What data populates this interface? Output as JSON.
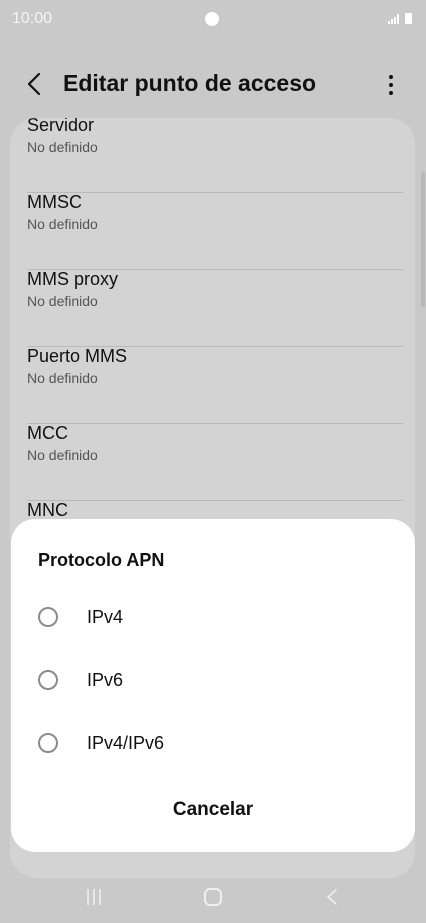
{
  "status_bar": {
    "time": "10:00",
    "icons": [
      "notification-dot-icon",
      "signal-icon",
      "battery-icon"
    ]
  },
  "app_bar": {
    "title": "Editar punto de acceso",
    "back_icon": "back-arrow-icon",
    "menu_icon": "more-vert-icon"
  },
  "settings": {
    "items": [
      {
        "title": "Servidor",
        "value": "No definido"
      },
      {
        "title": "MMSC",
        "value": "No definido"
      },
      {
        "title": "MMS proxy",
        "value": "No definido"
      },
      {
        "title": "Puerto MMS",
        "value": "No definido"
      },
      {
        "title": "MCC",
        "value": "No definido"
      },
      {
        "title": "MNC",
        "value": ""
      }
    ]
  },
  "dialog": {
    "title": "Protocolo APN",
    "options": [
      {
        "label": "IPv4",
        "selected": false
      },
      {
        "label": "IPv6",
        "selected": false
      },
      {
        "label": "IPv4/IPv6",
        "selected": false
      }
    ],
    "cancel_label": "Cancelar"
  },
  "nav_bar": {
    "icons": [
      "recent-apps-icon",
      "home-icon",
      "back-icon"
    ]
  }
}
